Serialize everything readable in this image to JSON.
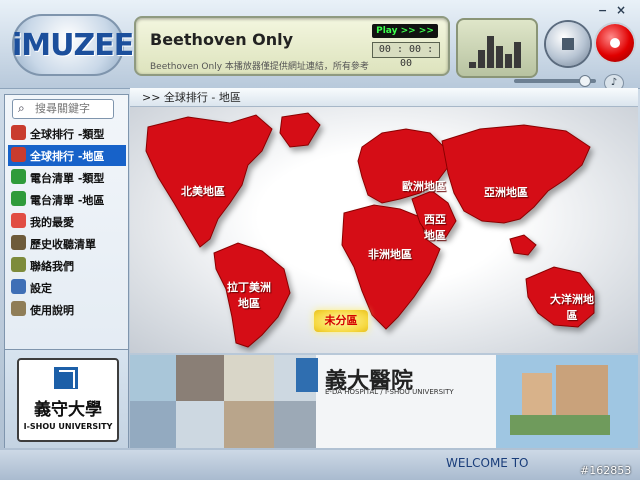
{
  "header": {
    "logo_text": "iMUZEE",
    "song_title": "Beethoven Only",
    "status": "Play >> >>",
    "time": "00 : 00 : 00",
    "marquee": "Beethoven Only    本播放器僅提供網址連結，所有參考",
    "volume_fraction": 0.9
  },
  "search": {
    "placeholder": "搜尋關鍵字"
  },
  "breadcrumb": ">> 全球排行  - 地區",
  "sidebar": {
    "items": [
      {
        "label": "全球排行 -類型",
        "icon": "globe-icon",
        "color": "#c93c2e",
        "active": false
      },
      {
        "label": "全球排行 -地區",
        "icon": "globe-icon",
        "color": "#c93c2e",
        "active": true
      },
      {
        "label": "電台清單 -類型",
        "icon": "music-note-icon",
        "color": "#2f9b3a",
        "active": false
      },
      {
        "label": "電台清單 -地區",
        "icon": "music-note-icon",
        "color": "#2f9b3a",
        "active": false
      },
      {
        "label": "我的最愛",
        "icon": "heart-icon",
        "color": "#e14d43",
        "active": false
      },
      {
        "label": "歷史收聽清單",
        "icon": "history-icon",
        "color": "#6e5b3a",
        "active": false
      },
      {
        "label": "聯絡我們",
        "icon": "contact-icon",
        "color": "#7d8b3c",
        "active": false
      },
      {
        "label": "設定",
        "icon": "settings-icon",
        "color": "#3f6fb6",
        "active": false
      },
      {
        "label": "使用說明",
        "icon": "help-book-icon",
        "color": "#8f7d57",
        "active": false
      }
    ]
  },
  "sponsor": {
    "name_cn": "義守大學",
    "name_en": "I-SHOU UNIVERSITY"
  },
  "map": {
    "regions": [
      "北美地區",
      "拉丁美洲地區",
      "歐洲地區",
      "非洲地區",
      "西亞地區",
      "亞洲地區",
      "大洋洲地區"
    ],
    "unassigned": "未分區"
  },
  "banner": {
    "cn_title": "義大醫院",
    "en_title": "E-DA HOSPITAL / I-SHOU UNIVERSITY"
  },
  "footer": {
    "welcome": "WELCOME TO",
    "id": "#162853"
  }
}
